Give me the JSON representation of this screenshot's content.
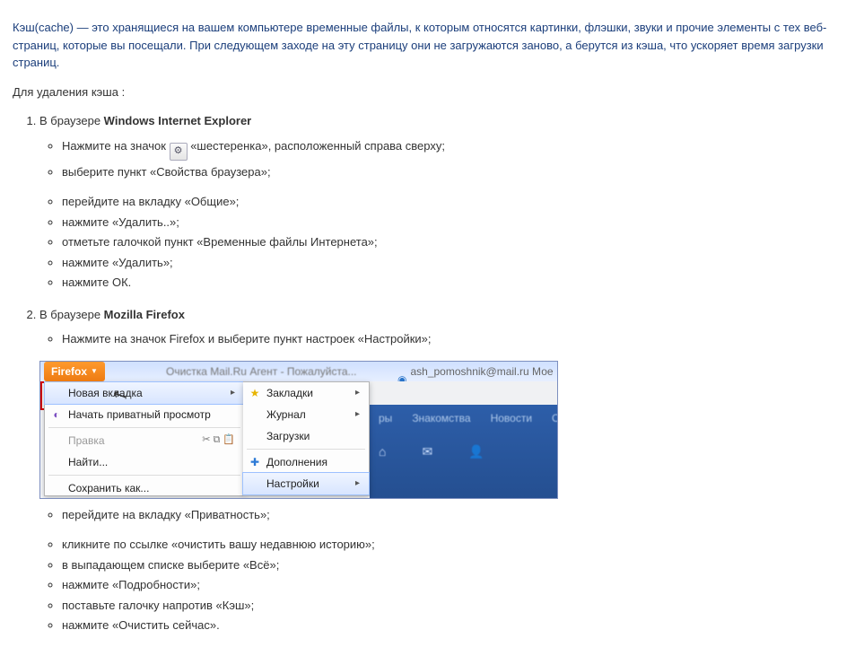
{
  "intro": "Кэш(cache) — это хранящиеся на вашем компьютере временные файлы, к которым относятся картинки, флэшки, звуки и прочие элементы с тех веб-страниц, которые вы посещали. При следующем заходе на эту страницу они не загружаются заново, а берутся из кэша, что ускоряет время загрузки страниц.",
  "delete_heading": "Для удаления кэша :",
  "ie": {
    "prefix": "В браузере ",
    "name": "Windows Internet Explorer",
    "s1a": "Нажмите на значок ",
    "s1b": " «шестеренка», расположенный справа сверху;",
    "s2": "выберите пункт «Свойства браузера»;",
    "s3": "перейдите на вкладку «Общие»;",
    "s4": "нажмите «Удалить..»;",
    "s5": "отметьте галочкой пункт «Временные файлы Интернета»;",
    "s6": "нажмите «Удалить»;",
    "s7": "нажмите ОК."
  },
  "ff": {
    "prefix": "В браузере ",
    "name": "Mozilla Firefox",
    "s1": "Нажмите на значок Firefox и выберите пункт настроек «Настройки»;",
    "s2": "перейдите на вкладку «Приватность»;",
    "s3": "кликните по ссылке «очистить вашу недавнюю историю»;",
    "s4": "в выпадающем списке выберите «Всё»;",
    "s5": "нажмите «Подробности»;",
    "s6": "поставьте галочку напротив «Кэш»;",
    "s7": "нажмите «Очистить сейчас»."
  },
  "ffmenu": {
    "button": "Firefox",
    "tab1": "Очистка Mail.Ru Агент - Пожалуйста...",
    "tab2": "ash_pomoshnik@mail.ru Мое теле...",
    "left": {
      "new_tab": "Новая вкладка",
      "private": "Начать приватный просмотр",
      "edit": "Правка",
      "find": "Найти...",
      "saveas": "Сохранить как..."
    },
    "mid": {
      "bookmarks": "Закладки",
      "history": "Журнал",
      "downloads": "Загрузки",
      "addons": "Дополнения",
      "settings": "Настройки"
    },
    "right": {
      "settings": "Настройки"
    },
    "bg": {
      "a": "ры",
      "b": "Знакомства",
      "c": "Новости",
      "d": "О"
    }
  }
}
